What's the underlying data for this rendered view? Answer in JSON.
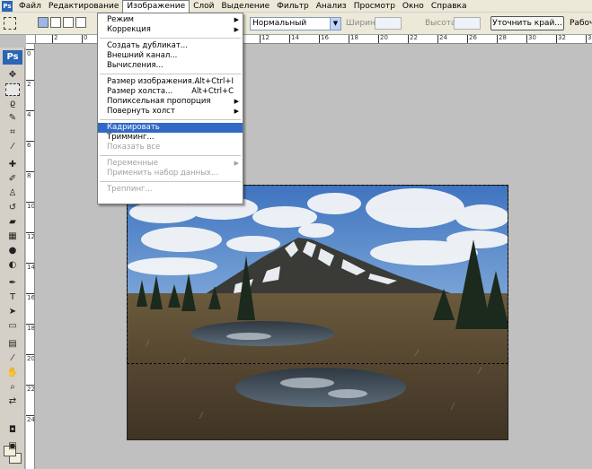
{
  "menubar": {
    "app_icon": "photoshop-icon",
    "items": [
      "Файл",
      "Редактирование",
      "Изображение",
      "Слой",
      "Выделение",
      "Фильтр",
      "Анализ",
      "Просмотр",
      "Окно",
      "Справка"
    ],
    "active_index": 2
  },
  "options": {
    "style_value": "Нормальный",
    "width_label": "Ширина:",
    "height_label": "Высота:",
    "refine_edge": "Уточнить край...",
    "workspace": "Рабочая"
  },
  "toolbox": {
    "logo": "Ps"
  },
  "ruler_top": [
    "2",
    "0",
    "2",
    "4",
    "6",
    "8",
    "10",
    "12",
    "14",
    "16",
    "18",
    "20",
    "22",
    "24",
    "26",
    "28",
    "30",
    "32",
    "34"
  ],
  "ruler_left": [
    "0",
    "2",
    "4",
    "6",
    "8",
    "10",
    "12",
    "14",
    "16",
    "18",
    "20",
    "22",
    "24"
  ],
  "image_menu": {
    "items": [
      {
        "label": "Режим",
        "submenu": true
      },
      {
        "label": "Коррекция",
        "submenu": true
      },
      {
        "label": "Создать дубликат..."
      },
      {
        "label": "Внешний канал..."
      },
      {
        "label": "Вычисления..."
      },
      {
        "label": "Размер изображения...",
        "shortcut": "Alt+Ctrl+I"
      },
      {
        "label": "Размер холста...",
        "shortcut": "Alt+Ctrl+C"
      },
      {
        "label": "Попиксельная пропорция",
        "submenu": true
      },
      {
        "label": "Повернуть холст",
        "submenu": true
      },
      {
        "label": "Кадрировать",
        "highlighted": true
      },
      {
        "label": "Тримминг..."
      },
      {
        "label": "Показать все",
        "disabled": true
      },
      {
        "label": "Переменные",
        "submenu": true,
        "disabled": true
      },
      {
        "label": "Применить набор данных...",
        "disabled": true
      },
      {
        "label": "Треппинг...",
        "disabled": true
      }
    ]
  },
  "colors": {
    "menu_highlight": "#316ac5",
    "chrome": "#ece9d8",
    "canvas_bg": "#c0c0c0"
  }
}
